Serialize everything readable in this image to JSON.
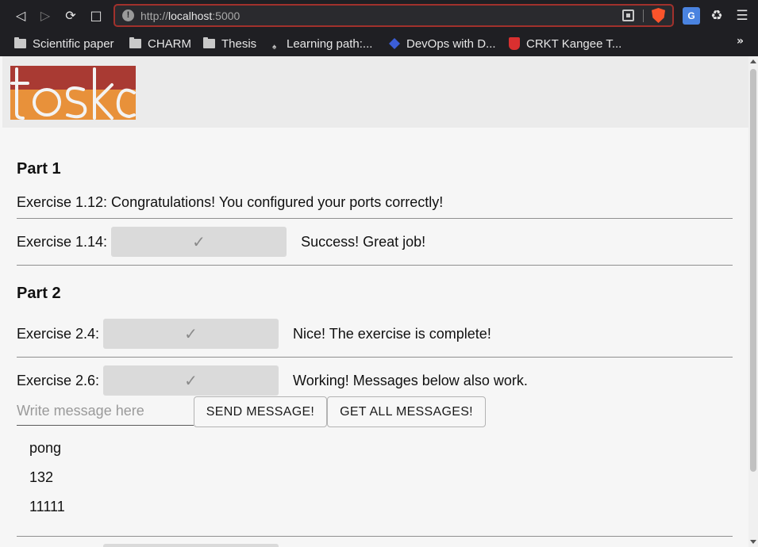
{
  "browser": {
    "url_scheme": "http://",
    "url_host": "localhost",
    "url_rest": ":5000",
    "bookmarks": [
      {
        "label": "Scientific paper",
        "icon": "folder-icon"
      },
      {
        "label": "CHARM",
        "icon": "folder-icon"
      },
      {
        "label": "Thesis",
        "icon": "folder-icon"
      },
      {
        "label": "Learning path:...",
        "icon": "learning-path-icon"
      },
      {
        "label": "DevOps with D...",
        "icon": "devops-icon"
      },
      {
        "label": "CRKT Kangee T...",
        "icon": "crkt-icon"
      }
    ],
    "more_label": "»"
  },
  "logo": {
    "text": "toska",
    "colors": [
      "#a93a33",
      "#e8913a"
    ]
  },
  "sections": [
    {
      "title": "Part 1"
    },
    {
      "title": "Part 2"
    }
  ],
  "exercises": {
    "ex_1_12": "Exercise 1.12: Congratulations! You configured your ports correctly!",
    "ex_1_14": {
      "label": "Exercise 1.14:",
      "message": "Success! Great job!"
    },
    "ex_2_4": {
      "label": "Exercise 2.4:",
      "message": "Nice! The exercise is complete!"
    },
    "ex_2_6": {
      "label": "Exercise 2.6:",
      "message": "Working! Messages below also work."
    }
  },
  "messaging": {
    "placeholder": "Write message here",
    "send_label": "SEND MESSAGE!",
    "get_label": "GET ALL MESSAGES!",
    "messages": [
      "pong",
      "132",
      "11111"
    ]
  },
  "colors": {
    "accent_border": "#a1312c",
    "check_bg": "#dadada"
  }
}
